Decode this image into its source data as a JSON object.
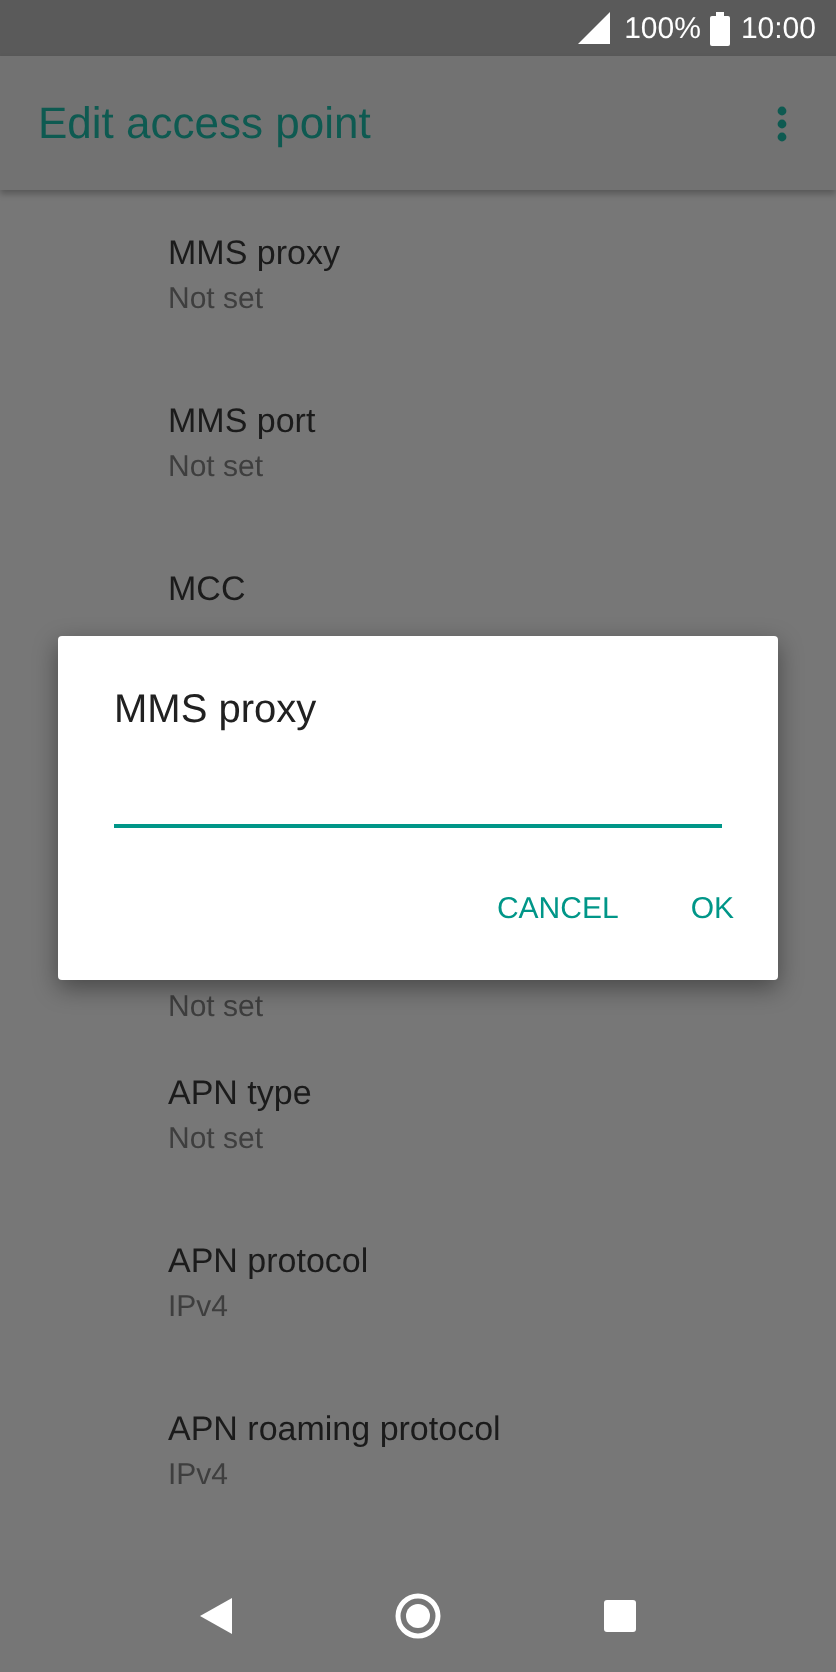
{
  "status_bar": {
    "battery": "100%",
    "time": "10:00"
  },
  "app_bar": {
    "title": "Edit access point"
  },
  "settings": [
    {
      "title": "MMS proxy",
      "summary": "Not set"
    },
    {
      "title": "MMS port",
      "summary": "Not set"
    },
    {
      "title": "MCC"
    },
    {
      "summary": "Not set"
    },
    {
      "title": "APN type",
      "summary": "Not set"
    },
    {
      "title": "APN protocol",
      "summary": "IPv4"
    },
    {
      "title": "APN roaming protocol",
      "summary": "IPv4"
    }
  ],
  "dialog": {
    "title": "MMS proxy",
    "buttons": [
      "CANCEL",
      "OK"
    ]
  }
}
